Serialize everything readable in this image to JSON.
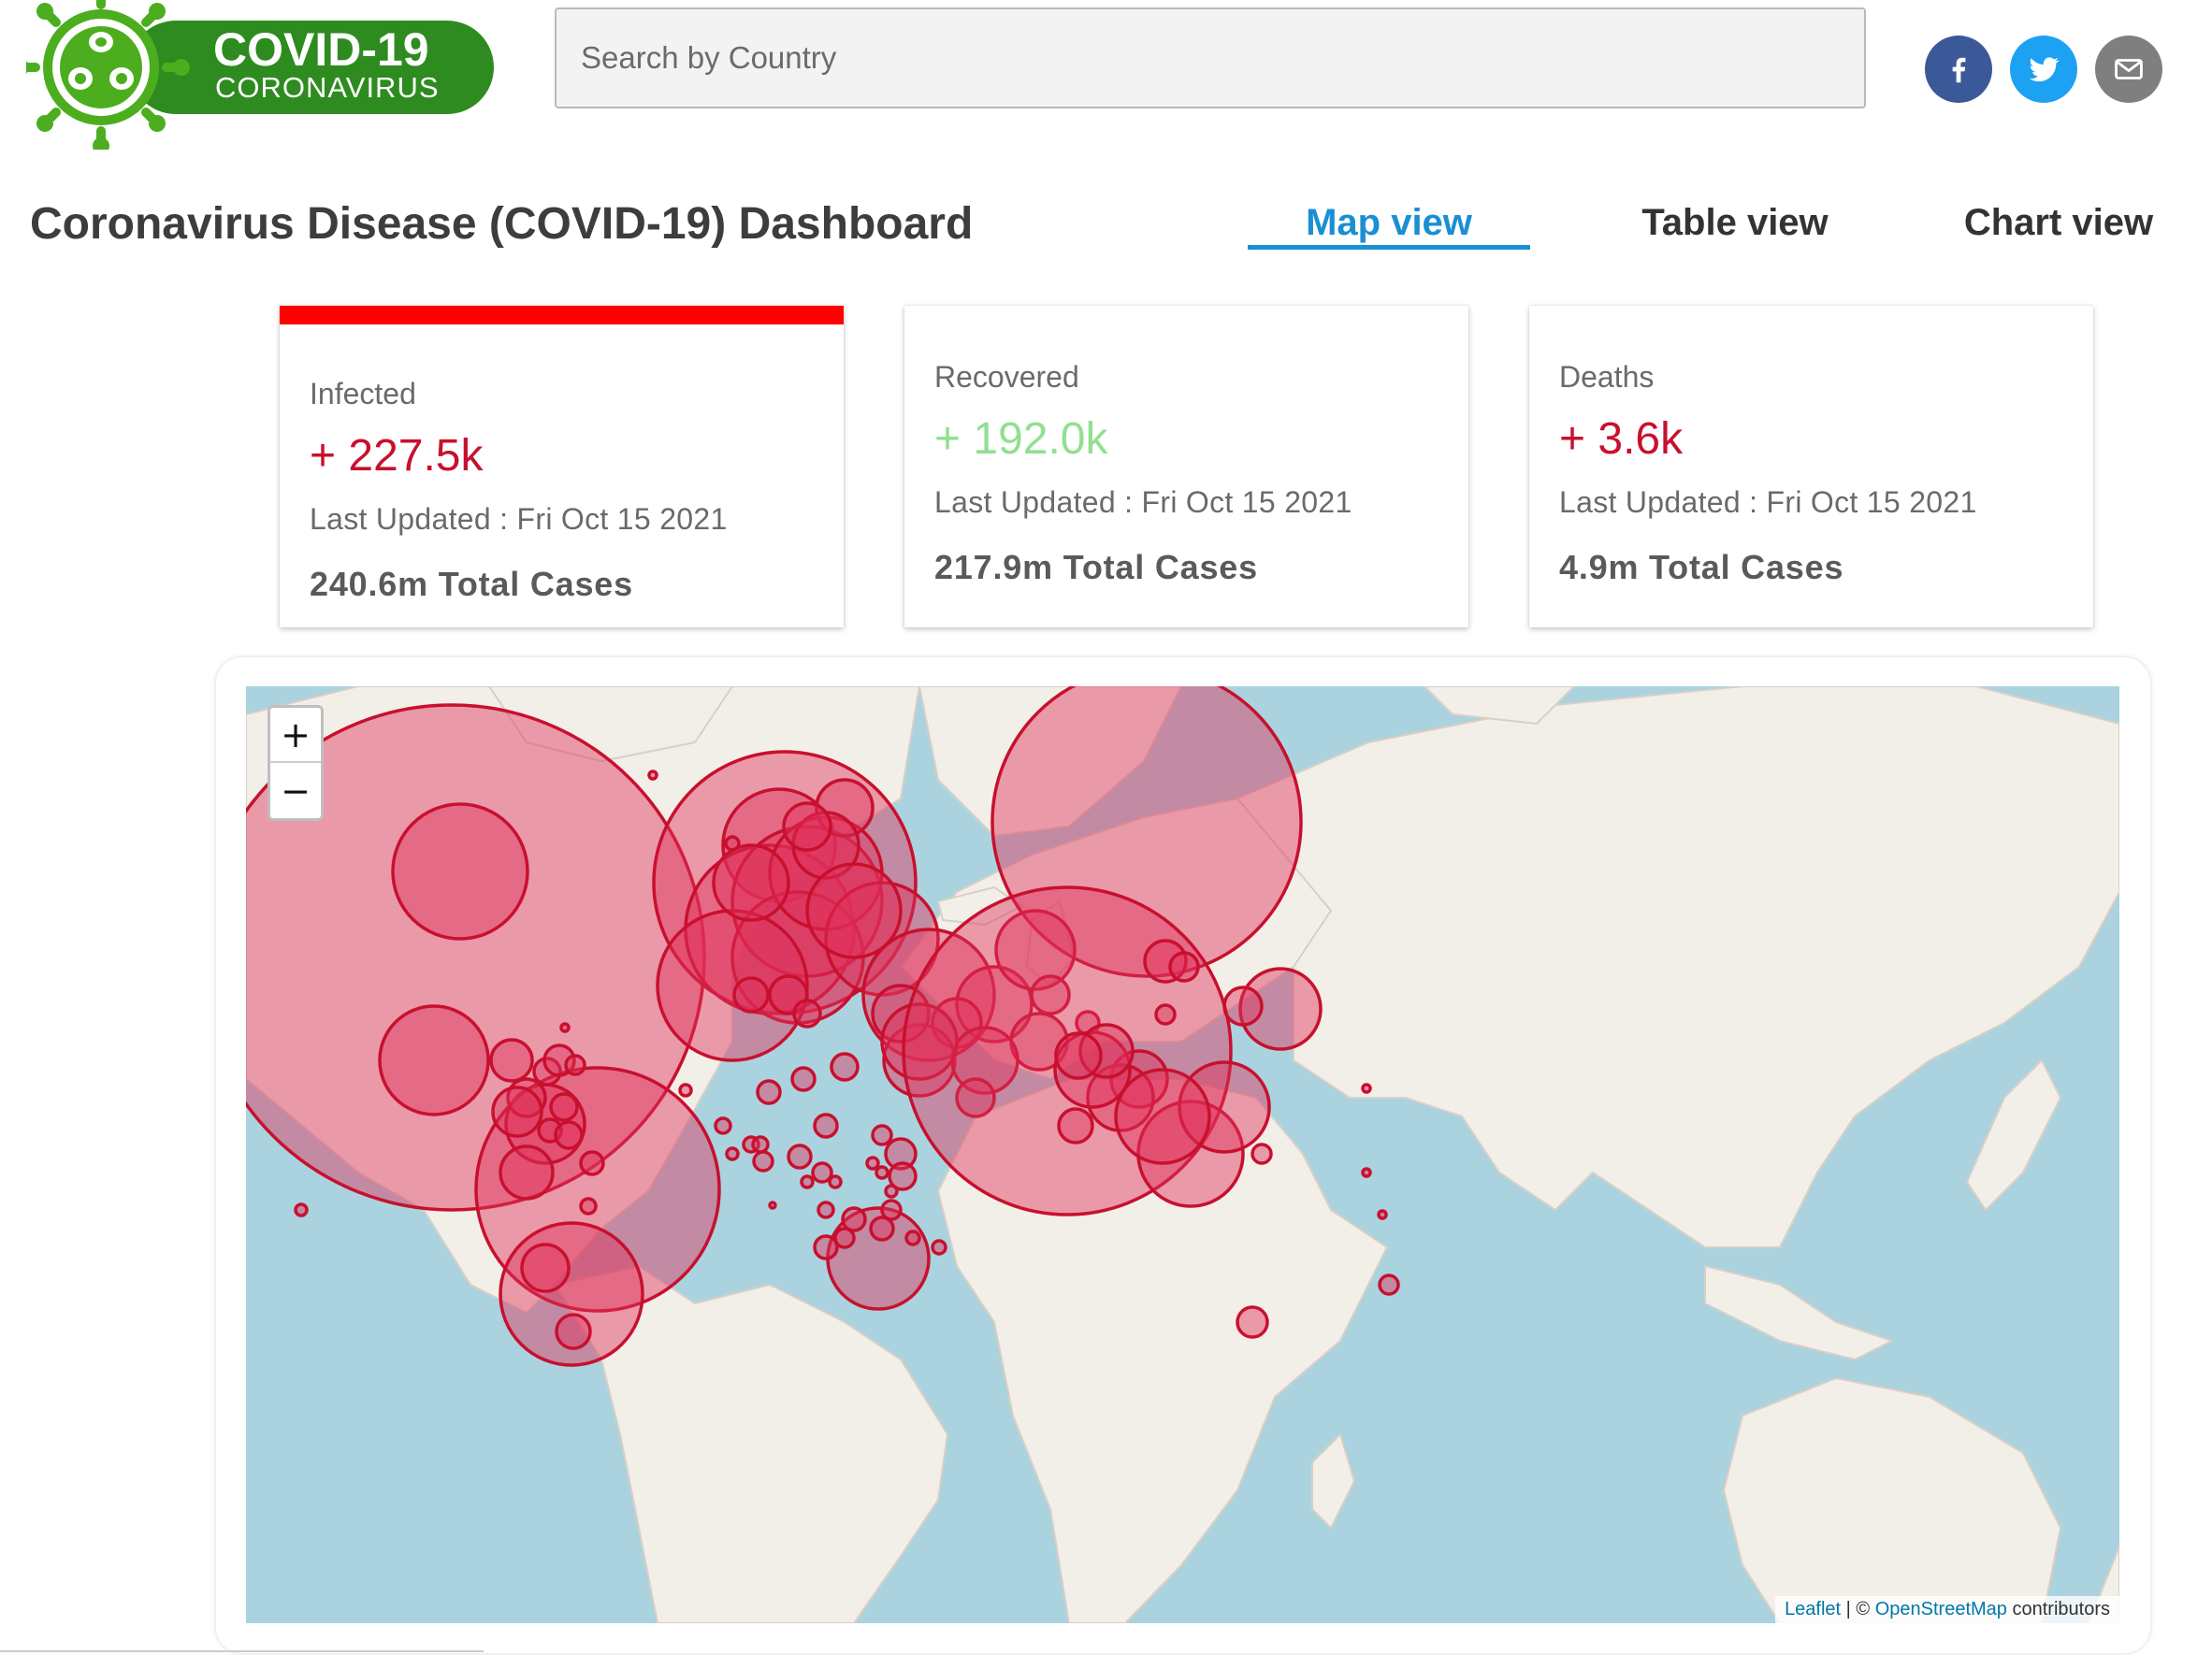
{
  "header": {
    "logo_title": "COVID-19",
    "logo_subtitle": "CORONAVIRUS",
    "search_placeholder": "Search by Country",
    "social": [
      "facebook-icon",
      "twitter-icon",
      "mail-icon"
    ]
  },
  "page_title": "Coronavirus Disease (COVID-19) Dashboard",
  "tabs": [
    {
      "label": "Map view",
      "active": true
    },
    {
      "label": "Table view",
      "active": false
    },
    {
      "label": "Chart view",
      "active": false
    }
  ],
  "cards": [
    {
      "label": "Infected",
      "new": "+ 227.5k",
      "updated": "Last Updated : Fri Oct 15 2021",
      "total": "240.6m Total Cases",
      "color": "#c8102e"
    },
    {
      "label": "Recovered",
      "new": "+ 192.0k",
      "updated": "Last Updated : Fri Oct 15 2021",
      "total": "217.9m Total Cases",
      "color": "#90e090"
    },
    {
      "label": "Deaths",
      "new": "+ 3.6k",
      "updated": "Last Updated : Fri Oct 15 2021",
      "total": "4.9m Total Cases",
      "color": "#c8102e"
    }
  ],
  "map": {
    "zoom_in": "+",
    "zoom_out": "−",
    "attribution": {
      "leaflet": "Leaflet",
      "sep": " | © ",
      "osm": "OpenStreetMap",
      "suffix": " contributors"
    },
    "colors": {
      "ocean": "#aad3df",
      "land": "#f2efe9",
      "circle_stroke": "#c8102e",
      "circle_fill": "#e0315a"
    }
  }
}
